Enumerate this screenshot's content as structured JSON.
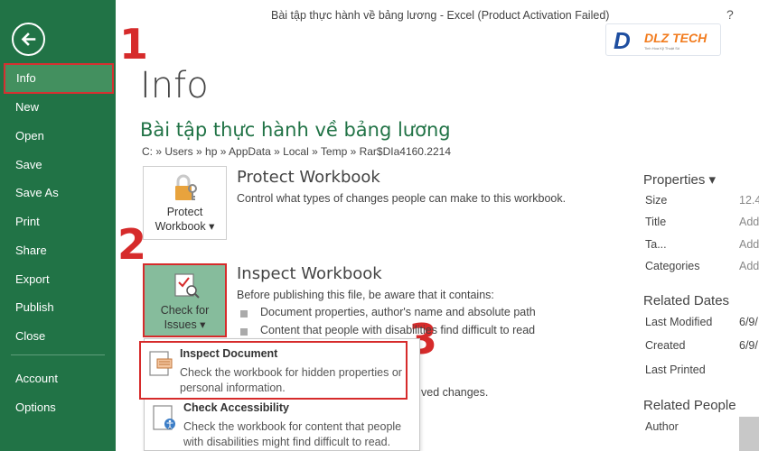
{
  "window": {
    "title": "Bài tập thực hành về bảng lương - Excel (Product Activation Failed)",
    "help": "?"
  },
  "logo": {
    "mark": "D",
    "text": "DLZ TECH",
    "tagline": "Tinh Hoa Kỹ Thuật Số"
  },
  "sidebar": {
    "items": [
      {
        "label": "Info"
      },
      {
        "label": "New"
      },
      {
        "label": "Open"
      },
      {
        "label": "Save"
      },
      {
        "label": "Save As"
      },
      {
        "label": "Print"
      },
      {
        "label": "Share"
      },
      {
        "label": "Export"
      },
      {
        "label": "Publish"
      },
      {
        "label": "Close"
      },
      {
        "label": "Account"
      },
      {
        "label": "Options"
      }
    ]
  },
  "page": {
    "title": "Info",
    "doc_name": "Bài tập thực hành về bảng lương",
    "path": "C: » Users » hp » AppData » Local » Temp » Rar$DIa4160.2214"
  },
  "markers": [
    "1",
    "2",
    "3"
  ],
  "protect": {
    "tile_line1": "Protect",
    "tile_line2": "Workbook ▾",
    "title": "Protect Workbook",
    "desc": "Control what types of changes people can make to this workbook."
  },
  "inspect": {
    "tile_line1": "Check for",
    "tile_line2": "Issues ▾",
    "title": "Inspect Workbook",
    "desc": "Before publishing this file, be aware that it contains:",
    "bullets": [
      "Document properties, author's name and absolute path",
      "Content that people with disabilities find difficult to read"
    ],
    "hidden_tail": "ved changes."
  },
  "menu": {
    "items": [
      {
        "title": "Inspect Document",
        "desc": "Check the workbook for hidden properties or personal information."
      },
      {
        "title": "Check Accessibility",
        "desc": "Check the workbook for content that people with disabilities might find difficult to read."
      }
    ]
  },
  "properties": {
    "header": "Properties ▾",
    "rows": [
      {
        "label": "Size",
        "value": "12.4"
      },
      {
        "label": "Title",
        "value": "Add"
      },
      {
        "label": "Ta...",
        "value": "Add"
      },
      {
        "label": "Categories",
        "value": "Add"
      }
    ],
    "dates_header": "Related Dates",
    "dates": [
      {
        "label": "Last Modified",
        "value": "6/9/"
      },
      {
        "label": "Created",
        "value": "6/9/"
      },
      {
        "label": "Last Printed",
        "value": ""
      }
    ],
    "people_header": "Related People",
    "people": [
      {
        "label": "Author"
      }
    ]
  }
}
